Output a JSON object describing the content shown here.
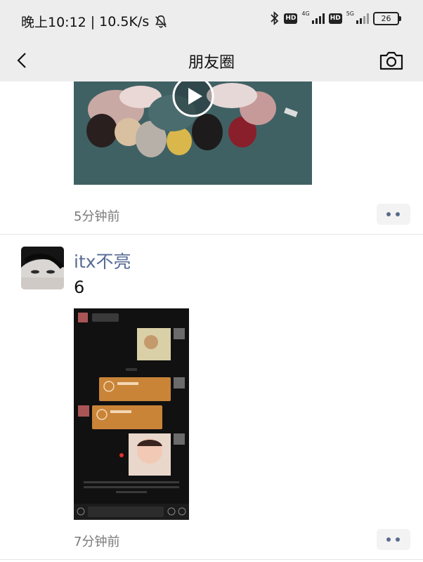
{
  "status_bar": {
    "time": "晚上10:12",
    "net_speed": "10.5K/s",
    "hd1": "HD",
    "net1": "4G",
    "hd2": "HD",
    "net2": "5G",
    "battery": "26"
  },
  "nav": {
    "title": "朋友圈"
  },
  "posts": [
    {
      "time": "5分钟前",
      "media": "video"
    },
    {
      "username": "itx不亮",
      "text": "6",
      "time": "7分钟前",
      "media": "image"
    }
  ],
  "icons": [
    "mute-icon",
    "bluetooth-icon",
    "signal-icon",
    "battery-icon",
    "back-icon",
    "camera-icon",
    "play-icon",
    "more-icon"
  ],
  "colors": {
    "bar_bg": "#ededed",
    "username": "#576b95",
    "timestamp": "#7a7a7a"
  }
}
